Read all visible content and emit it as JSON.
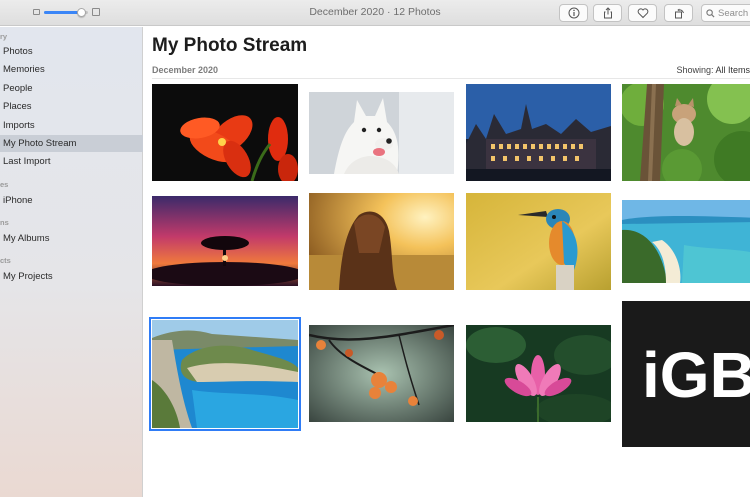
{
  "window": {
    "title": "December 2020 · 12 Photos"
  },
  "toolbar": {
    "info_icon": "info-icon",
    "share_icon": "share-icon",
    "favorite_icon": "heart-icon",
    "rotate_icon": "rotate-icon",
    "search_placeholder": "Search",
    "zoom_level": 0.85
  },
  "sidebar": {
    "sections": [
      {
        "heading": "ry",
        "items": [
          {
            "label": "Photos"
          },
          {
            "label": "Memories"
          },
          {
            "label": "People"
          },
          {
            "label": "Places"
          },
          {
            "label": "Imports"
          },
          {
            "label": "My Photo Stream",
            "selected": true
          },
          {
            "label": "Last Import"
          }
        ]
      },
      {
        "heading": "es",
        "items": [
          {
            "label": "iPhone"
          }
        ]
      },
      {
        "heading": "ns",
        "items": [
          {
            "label": "My Albums"
          }
        ]
      },
      {
        "heading": "cts",
        "items": [
          {
            "label": "My Projects"
          }
        ]
      }
    ]
  },
  "main": {
    "title": "My Photo Stream",
    "section_date": "December 2020",
    "showing_label": "Showing:",
    "showing_value": "All Items",
    "logo_text": "iGB",
    "photos": [
      {
        "subject": "red-amaryllis-flower"
      },
      {
        "subject": "white-dog"
      },
      {
        "subject": "historic-building-at-dusk"
      },
      {
        "subject": "cat-in-tree"
      },
      {
        "subject": "tree-silhouette-sunset"
      },
      {
        "subject": "girl-in-sunlit-field"
      },
      {
        "subject": "kingfisher-bird"
      },
      {
        "subject": "tropical-beach"
      },
      {
        "subject": "shipwreck-beach-cove",
        "selected": true
      },
      {
        "subject": "orange-blossoms"
      },
      {
        "subject": "pink-lotus"
      },
      {
        "subject": "igb-logo"
      }
    ]
  }
}
